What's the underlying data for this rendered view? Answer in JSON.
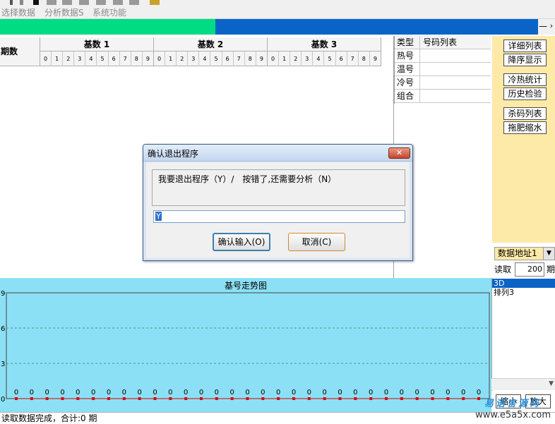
{
  "menu": {
    "items": [
      {
        "label": "选择数据"
      },
      {
        "label": "分析数据S"
      },
      {
        "label": "系统功能"
      }
    ]
  },
  "progress": {
    "fraction": 0.4,
    "minimize_label": "—",
    "next_label": "›",
    "fill_color": "#00dc82",
    "track_color": "#0a64c8"
  },
  "grid": {
    "period_header": "期数",
    "groups": [
      {
        "title": "基数 1"
      },
      {
        "title": "基数 2"
      },
      {
        "title": "基数 3"
      }
    ],
    "digits": [
      "0",
      "1",
      "2",
      "3",
      "4",
      "5",
      "6",
      "7",
      "8",
      "9"
    ]
  },
  "type_table": {
    "col_type": "类型",
    "col_list": "号码列表",
    "rows": [
      {
        "type": "热号",
        "list": ""
      },
      {
        "type": "温号",
        "list": ""
      },
      {
        "type": "冷号",
        "list": ""
      },
      {
        "type": "组合",
        "list": ""
      }
    ]
  },
  "right_panel": {
    "buttons": [
      {
        "label": "详细列表"
      },
      {
        "label": "降序显示"
      },
      {
        "label": "冷热统计"
      },
      {
        "label": "历史检验"
      },
      {
        "label": "杀码列表"
      },
      {
        "label": "拖肥缩水"
      }
    ],
    "address_select": "数据地址1",
    "read_label": "读取",
    "read_value": "200",
    "read_unit": "期",
    "list_items": [
      "3D",
      "排列3"
    ],
    "zoom_in": "缩小",
    "zoom_out": "放大",
    "panel_color": "#fde9a8"
  },
  "chart_data": {
    "type": "line",
    "title": "基号走势图",
    "ylim": [
      0,
      9
    ],
    "yticks": [
      0,
      3,
      6,
      9
    ],
    "grid": true,
    "background": "#8ce0f5",
    "point_color": "#e00000",
    "values": [
      0,
      0,
      0,
      0,
      0,
      0,
      0,
      0,
      0,
      0,
      0,
      0,
      0,
      0,
      0,
      0,
      0,
      0,
      0,
      0,
      0,
      0,
      0,
      0,
      0,
      0,
      0,
      0,
      0,
      0,
      0
    ]
  },
  "dialog": {
    "title": "确认退出程序",
    "close_label": "✕",
    "message": "我要退出程序（Y）/　按错了,还需要分析（N）",
    "input_value": "Y",
    "ok_label": "确认输入(O)",
    "cancel_label": "取消(C)"
  },
  "status": {
    "text": "读取数据完成，合计:0 期"
  },
  "watermark": {
    "line1": "易语言源码",
    "line2": "www.e5a5x.com"
  }
}
